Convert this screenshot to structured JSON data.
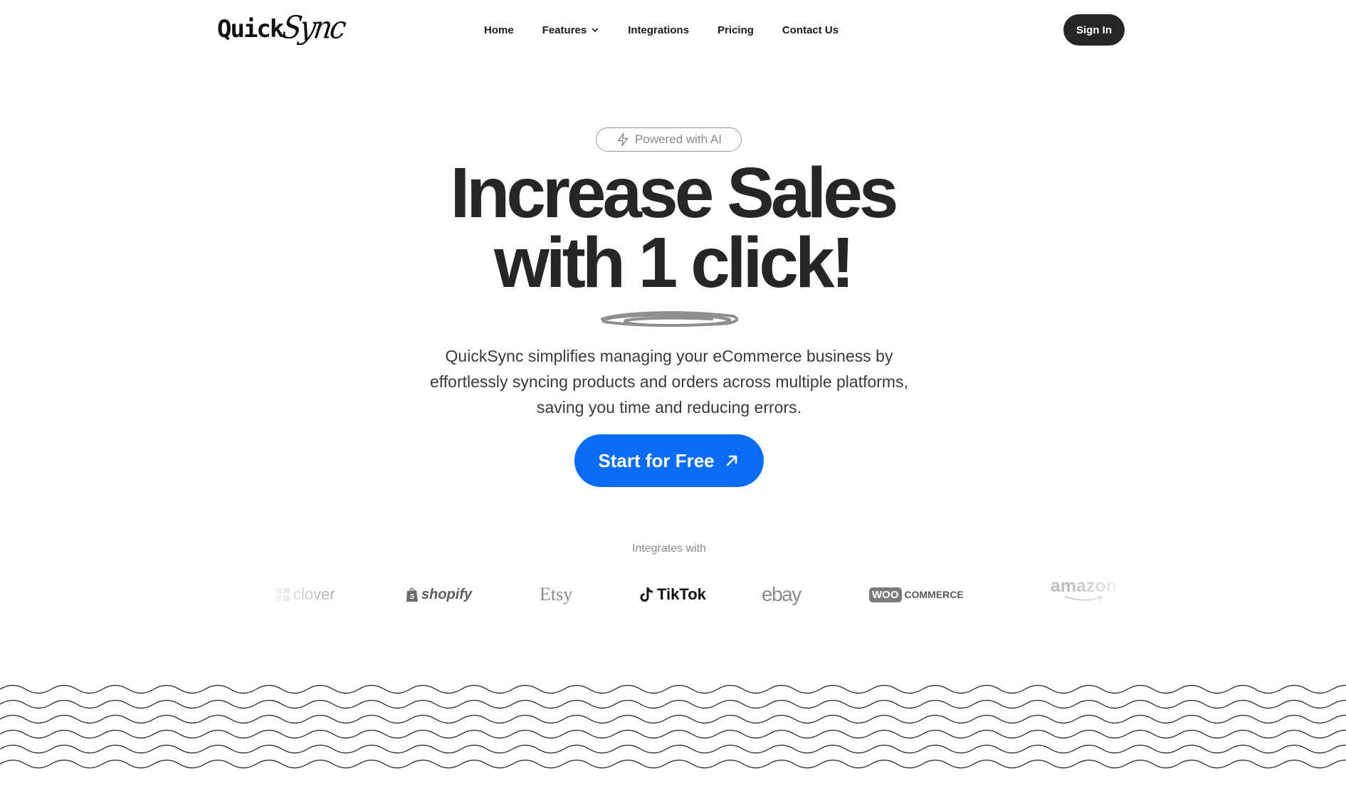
{
  "header": {
    "logo": {
      "part1": "Quick",
      "part2": "Sync"
    },
    "nav": [
      {
        "label": "Home"
      },
      {
        "label": "Features",
        "icon": "chevron-down-icon"
      },
      {
        "label": "Integrations"
      },
      {
        "label": "Pricing"
      },
      {
        "label": "Contact Us"
      }
    ],
    "sign_in_label": "Sign In"
  },
  "hero": {
    "badge": {
      "icon": "lightning-icon",
      "label": "Powered with AI"
    },
    "headline_line1": "Increase Sales",
    "headline_line2": "with 1 click!",
    "subtitle": "QuickSync simplifies managing your eCommerce business by effortlessly syncing products and orders across multiple platforms, saving you time and reducing errors.",
    "cta": {
      "label": "Start for Free",
      "icon": "arrow-up-right-icon",
      "color": "#0a6cf5"
    }
  },
  "integrations": {
    "label": "Integrates with",
    "brands": {
      "clover": "clover",
      "shopify": "shopify",
      "etsy": "Etsy",
      "tiktok": "TikTok",
      "ebay": "ebay",
      "woo_badge": "WOO",
      "woo_text": "COMMERCE",
      "amazon": "amazon"
    }
  },
  "colors": {
    "text_dark": "#262626",
    "accent": "#0a6cf5",
    "muted": "#8a8a8a"
  }
}
